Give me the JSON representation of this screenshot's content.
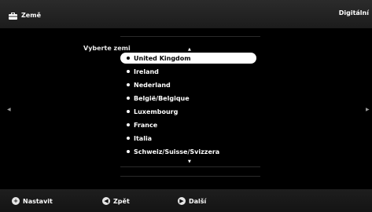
{
  "header": {
    "title": "Země",
    "mode": "Digitální",
    "icon": "briefcase-icon"
  },
  "main": {
    "prompt": "Vyberte zemi",
    "selected_index": 0,
    "countries": [
      "United Kingdom",
      "Ireland",
      "Nederland",
      "België/Belgique",
      "Luxembourg",
      "France",
      "Italia",
      "Schweiz/Suisse/Svizzera"
    ]
  },
  "footer": {
    "buttons": [
      {
        "label": "Nastavit",
        "icon": "plus-circle-icon"
      },
      {
        "label": "Zpět",
        "icon": "left-arrow-circle-icon"
      },
      {
        "label": "Další",
        "icon": "right-arrow-circle-icon"
      }
    ]
  },
  "colors": {
    "background": "#000000",
    "bar": "#1c1c1c",
    "selected_bg": "#ffffff",
    "text": "#ffffff"
  }
}
